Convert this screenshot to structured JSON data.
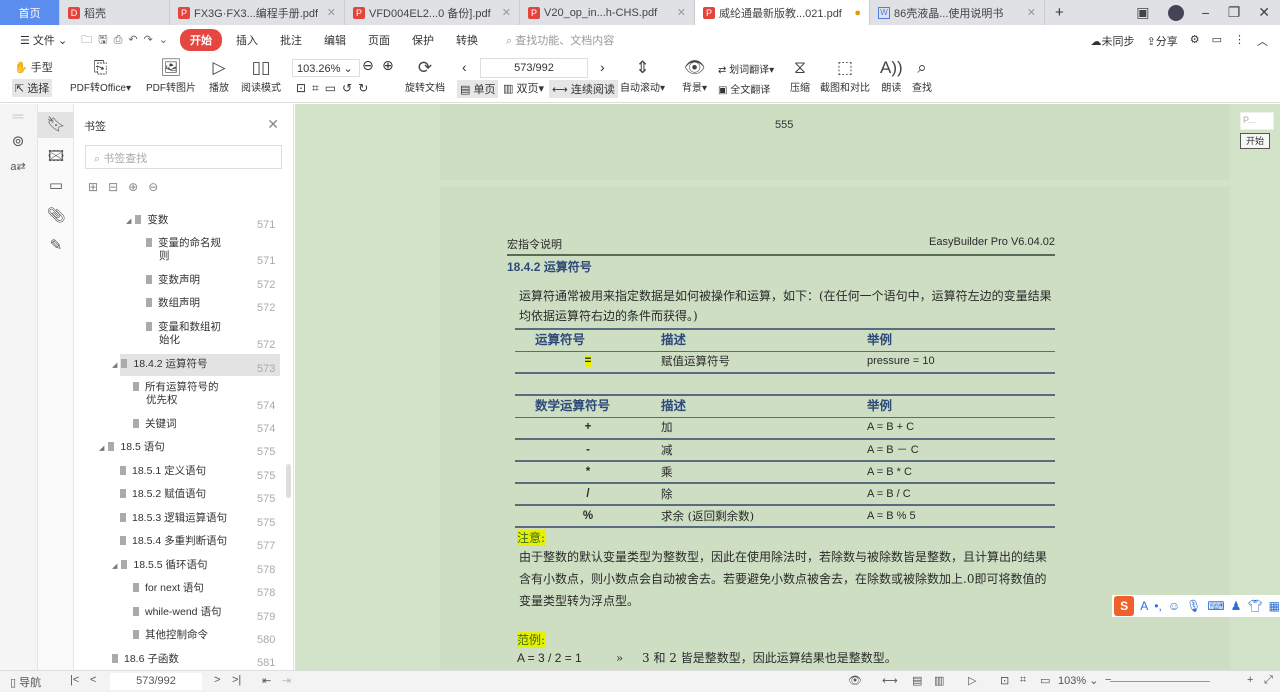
{
  "tabs": [
    {
      "label": "首页",
      "type": "home"
    },
    {
      "label": "稻壳",
      "type": "daoke"
    },
    {
      "label": "FX3G·FX3...编程手册.pdf",
      "type": "pdf"
    },
    {
      "label": "VFD004EL2...0 备份].pdf",
      "type": "pdf"
    },
    {
      "label": "V20_op_in...h-CHS.pdf",
      "type": "pdf"
    },
    {
      "label": "威纶通最新版教...021.pdf",
      "type": "pdf",
      "active": true
    },
    {
      "label": "86壳液晶...使用说明书",
      "type": "word"
    }
  ],
  "menu": {
    "file": "文件",
    "items": [
      "开始",
      "插入",
      "批注",
      "编辑",
      "页面",
      "保护",
      "转换"
    ],
    "search_placeholder": "查找功能、文档内容",
    "sync": "未同步",
    "share": "分享"
  },
  "toolbar": {
    "hand": "手型",
    "select": "选择",
    "pdf_office": "PDF转Office",
    "pdf_image": "PDF转图片",
    "play": "播放",
    "read_mode": "阅读模式",
    "zoom": "103.26%",
    "rotate": "旋转文档",
    "page": "573/992",
    "single": "单页",
    "double": "双页",
    "continuous": "连续阅读",
    "auto_scroll": "自动滚动",
    "background": "背景",
    "word_translate": "划词翻译",
    "full_translate": "全文翻译",
    "compress": "压缩",
    "screenshot": "截图和对比",
    "read_aloud": "朗读",
    "find": "查找"
  },
  "bookmarks": {
    "title": "书签",
    "search_placeholder": "书签查找",
    "items": [
      {
        "label": "变数",
        "page": "571"
      },
      {
        "label": "变量的命名规则",
        "page": "571"
      },
      {
        "label": "变数声明",
        "page": "572"
      },
      {
        "label": "数组声明",
        "page": "572"
      },
      {
        "label": "变量和数组初始化",
        "page": "572"
      },
      {
        "label": "18.4.2 运算符号",
        "page": "573"
      },
      {
        "label": "所有运算符号的优先权",
        "page": "574"
      },
      {
        "label": "关键词",
        "page": "574"
      },
      {
        "label": "18.5 语句",
        "page": "575"
      },
      {
        "label": "18.5.1 定义语句",
        "page": "575"
      },
      {
        "label": "18.5.2 赋值语句",
        "page": "575"
      },
      {
        "label": "18.5.3 逻辑运算语句",
        "page": "575"
      },
      {
        "label": "18.5.4 多重判断语句",
        "page": "577"
      },
      {
        "label": "18.5.5 循环语句",
        "page": "578"
      },
      {
        "label": "for next 语句",
        "page": "578"
      },
      {
        "label": "while-wend 语句",
        "page": "579"
      },
      {
        "label": "其他控制命令",
        "page": "580"
      },
      {
        "label": "18.6 子函数",
        "page": "581"
      }
    ]
  },
  "document": {
    "prev_page_number": "555",
    "header_left": "宏指令说明",
    "header_right": "EasyBuilder Pro V6.04.02",
    "section": "18.4.2  运算符号",
    "intro": "运算符通常被用来指定数据是如何被操作和运算，如下：(在任何一个语句中，运算符左边的变量结果均依据运算符右边的条件而获得。)",
    "table1": {
      "headers": [
        "运算符号",
        "描述",
        "举例"
      ],
      "rows": [
        [
          "=",
          "赋值运算符号",
          "pressure = 10"
        ]
      ]
    },
    "table2": {
      "headers": [
        "数学运算符号",
        "描述",
        "举例"
      ],
      "rows": [
        [
          "+",
          "加",
          "A = B + C"
        ],
        [
          "-",
          "减",
          "A = B  －  C"
        ],
        [
          "*",
          "乘",
          "A = B * C"
        ],
        [
          "/",
          "除",
          "A = B / C"
        ],
        [
          "%",
          "求余 (返回剩余数)",
          "A = B % 5"
        ]
      ]
    },
    "note_label": "注意:",
    "note_text": "由于整数的默认变量类型为整数型，因此在使用除法时，若除数与被除数皆是整数，且计算出的结果含有小数点，则小数点会自动被舍去。若要避免小数点被舍去，在除数或被除数加上.0即可将数值的变量类型转为浮点型。",
    "example_label": "范例:",
    "example_code": "A = 3 / 2 = 1",
    "example_arrow": "»",
    "example_text": "3 和 2 皆是整数型，因此运算结果也是整数型。"
  },
  "footer": {
    "nav": "导航",
    "page": "573/992",
    "zoom": "103%"
  },
  "popup": {
    "input": "P...",
    "button": "开始"
  },
  "colors": {
    "doc_bg": "#d2e3c8",
    "accent": "#e5463f",
    "highlight": "#e7f000",
    "heading": "#2f4a7a"
  }
}
